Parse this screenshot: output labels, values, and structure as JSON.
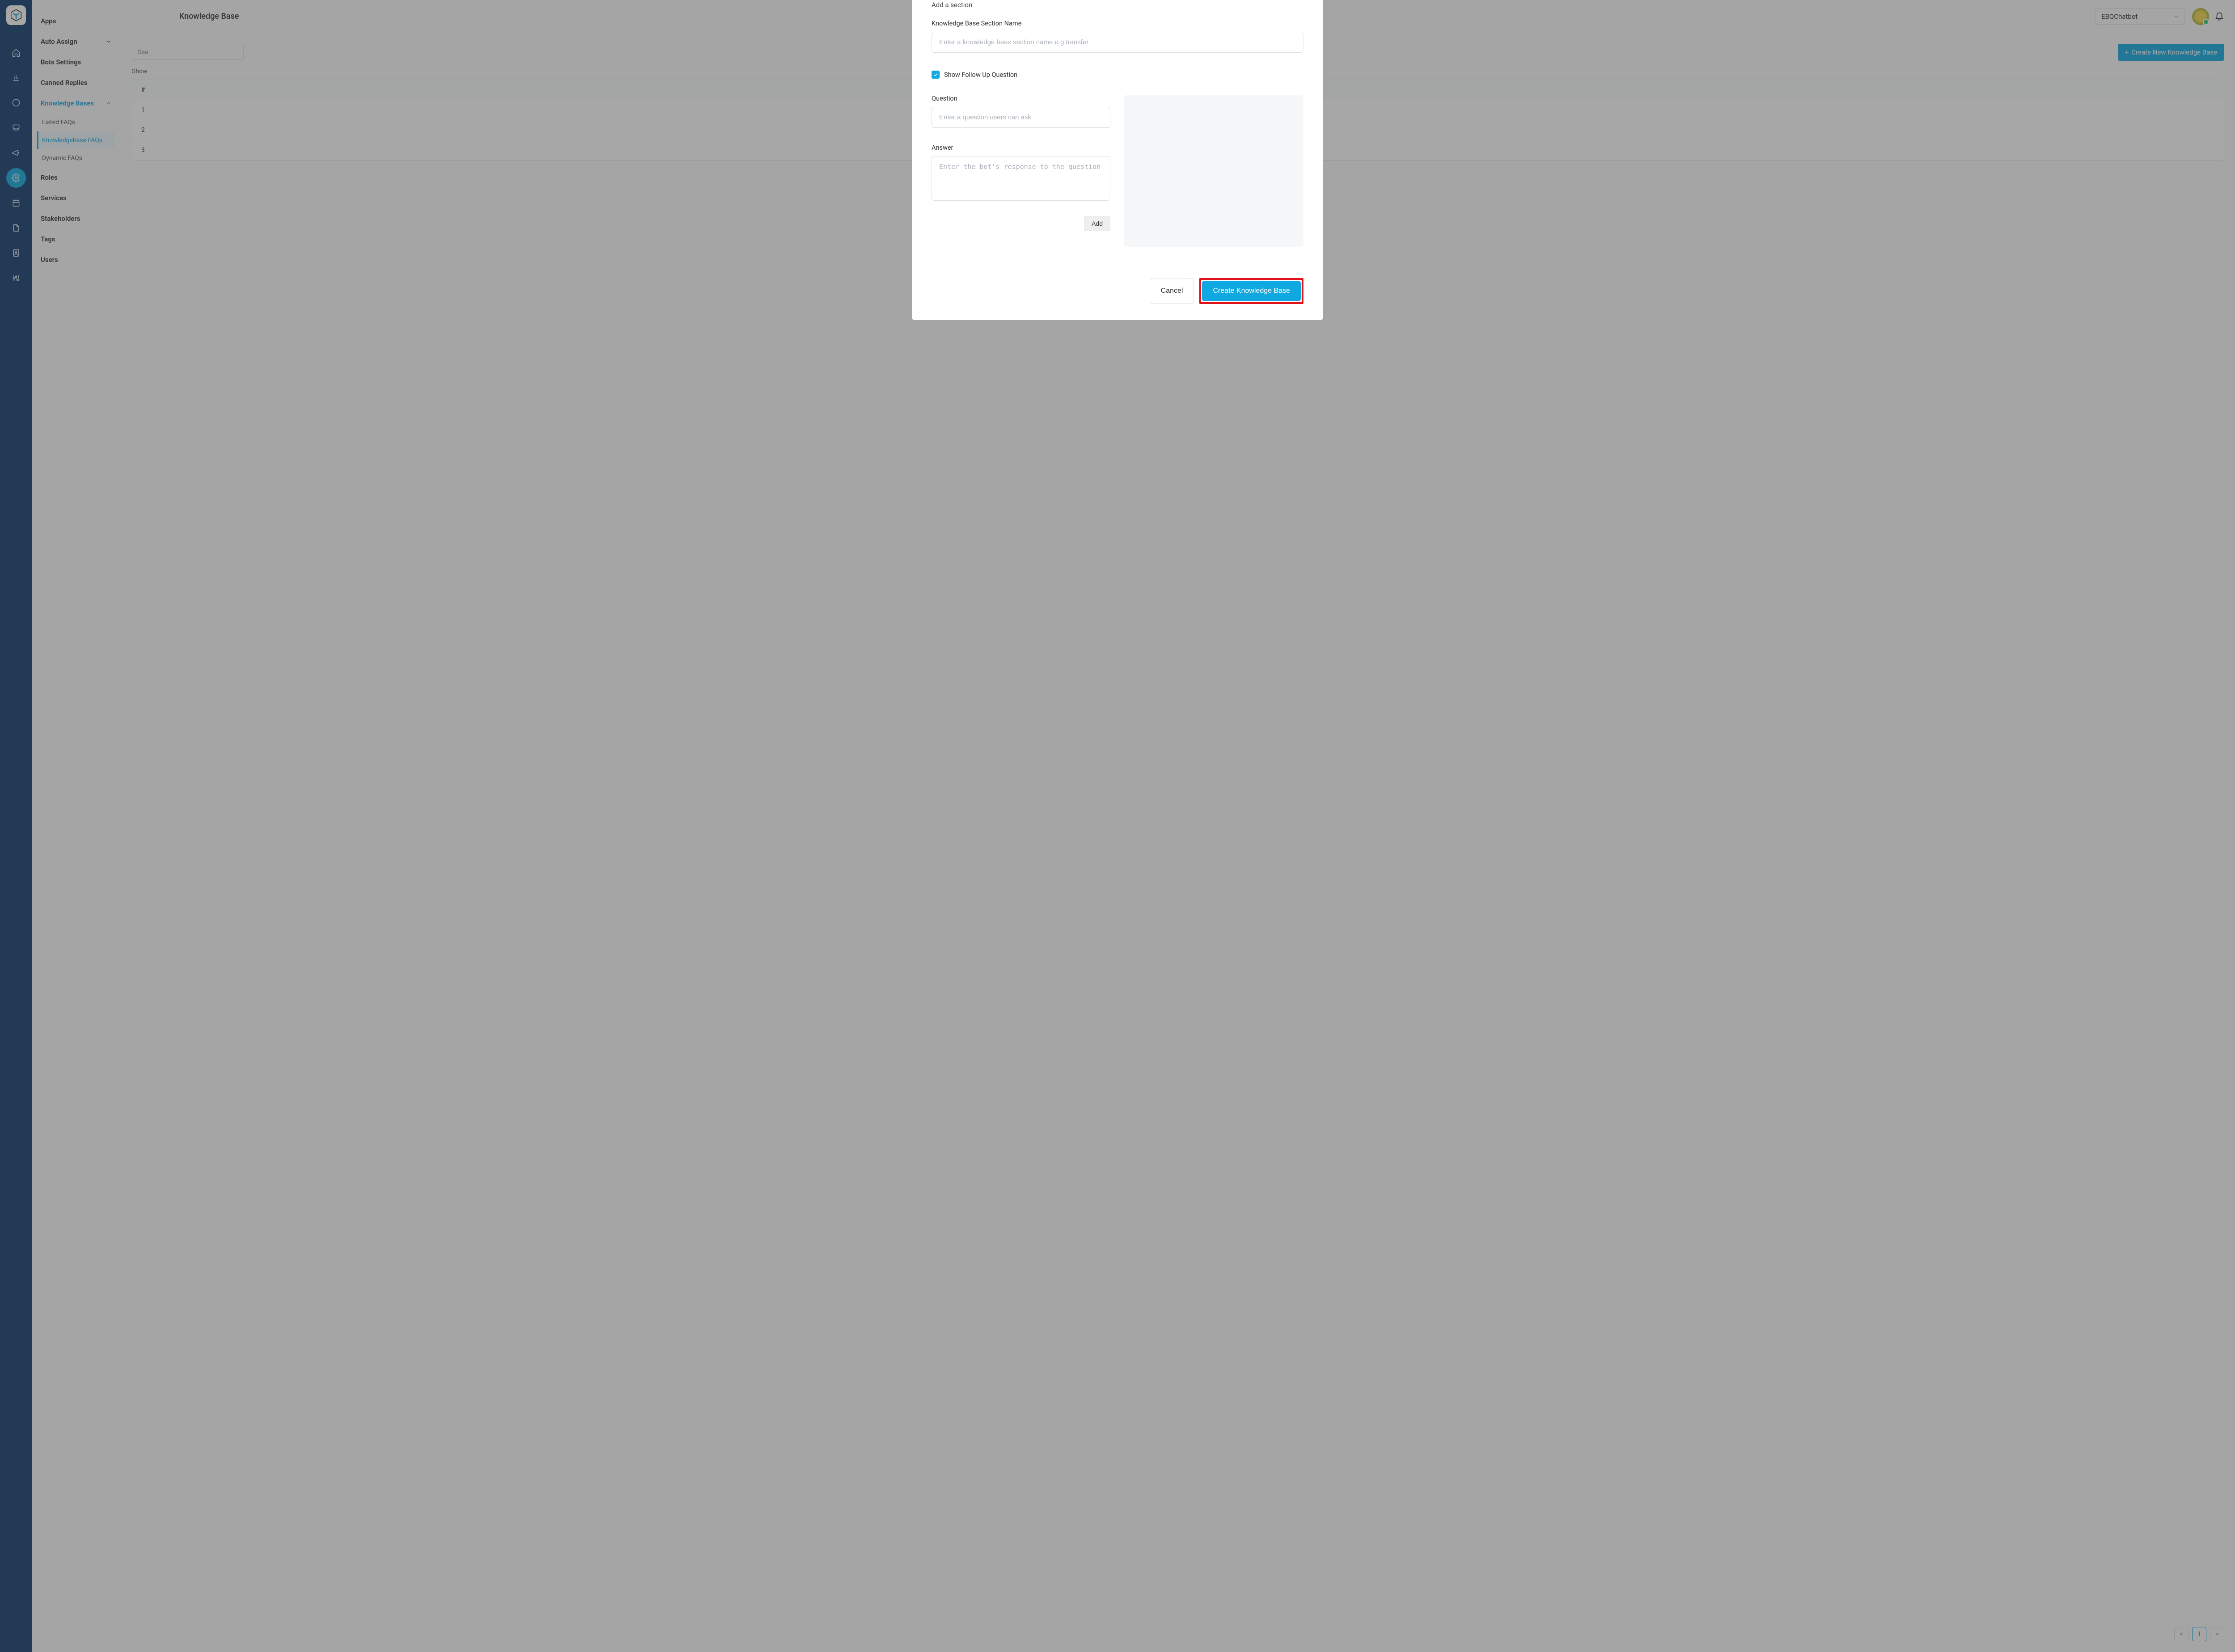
{
  "topbar": {
    "title": "Knowledge Base",
    "selected_bot": "EBQChatbot"
  },
  "sidebar": {
    "items": [
      {
        "label": "Apps"
      },
      {
        "label": "Auto Assign"
      },
      {
        "label": "Bots Settings"
      },
      {
        "label": "Canned Replies"
      },
      {
        "label": "Knowledge Bases"
      },
      {
        "label": "Roles"
      },
      {
        "label": "Services"
      },
      {
        "label": "Stakeholders"
      },
      {
        "label": "Tags"
      },
      {
        "label": "Users"
      }
    ],
    "sub_items": [
      {
        "label": "Listed FAQs"
      },
      {
        "label": "Knowledgebase FAQs"
      },
      {
        "label": "Dynamic FAQs"
      }
    ]
  },
  "content": {
    "search_placeholder": "Sea",
    "create_button": "Create New Knowledge Base",
    "show_label": "Show",
    "header_col": "#",
    "rows": [
      "1",
      "2",
      "3"
    ],
    "page": "1"
  },
  "modal": {
    "section_title": "Add a section",
    "field1_label": "Knowledge Base Section Name",
    "field1_placeholder": "Enter a knowledge base section name e.g transfer",
    "checkbox_label": "Show Follow Up Question",
    "question_label": "Question",
    "question_placeholder": "Enter a question users can ask",
    "answer_label": "Answer",
    "answer_placeholder": "Enter the bot's response to the question",
    "add_button": "Add",
    "cancel_button": "Cancel",
    "submit_button": "Create Knowledge Base"
  }
}
